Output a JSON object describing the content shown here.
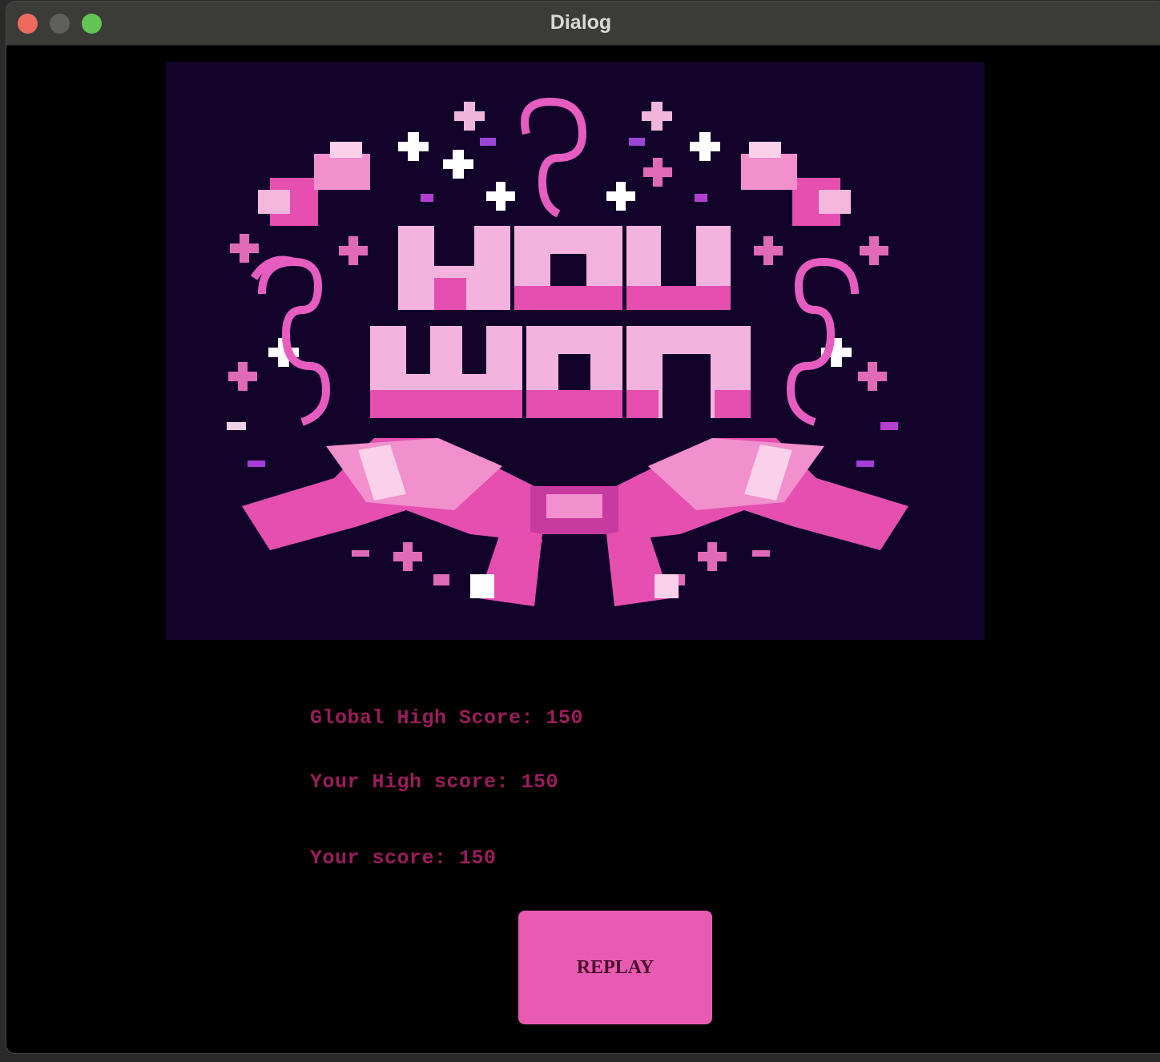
{
  "window": {
    "title": "Dialog"
  },
  "banner": {
    "line1": "YOU",
    "line2": "WON"
  },
  "scores": {
    "global_high": "Global High Score: 150",
    "your_high": "Your High score: 150",
    "yours": "Your score: 150"
  },
  "actions": {
    "replay_label": "REPLAY"
  },
  "colors": {
    "background": "#000000",
    "banner_bg": "#12032a",
    "score_text": "#9a1d5c",
    "button_bg": "#e85bb2",
    "button_text": "#4a0a2a"
  },
  "icons": {
    "close": "close-traffic-light",
    "minimize": "minimize-traffic-light",
    "maximize": "maximize-traffic-light"
  }
}
